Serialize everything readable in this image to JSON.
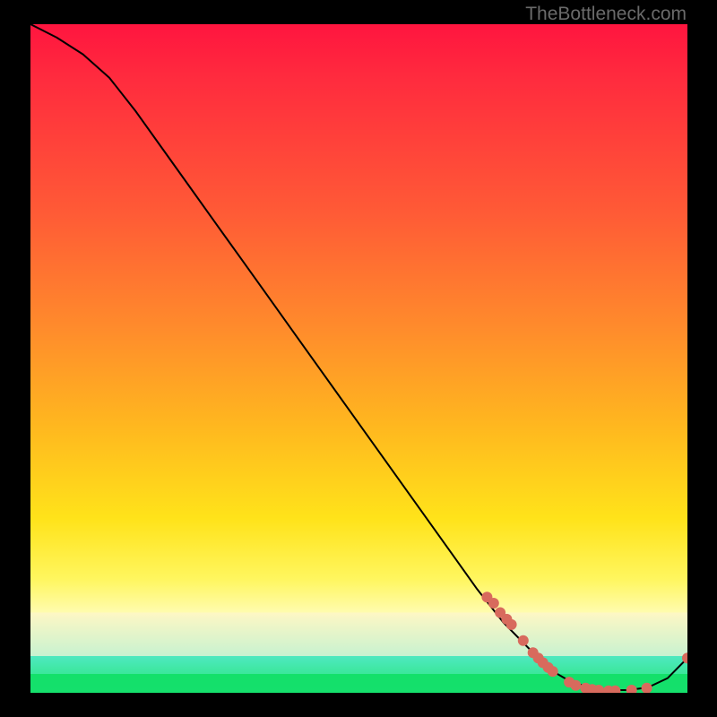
{
  "watermark": "TheBottleneck.com",
  "colors": {
    "curve": "#000000",
    "marker": "#d86a5d",
    "bg_top": "#ff153f",
    "bg_mid": "#ffe31a",
    "bg_band": "#13e06a"
  },
  "chart_data": {
    "type": "line",
    "title": "",
    "xlabel": "",
    "ylabel": "",
    "xlim": [
      0,
      100
    ],
    "ylim": [
      0,
      100
    ],
    "grid": false,
    "legend": false,
    "series": [
      {
        "name": "bottleneck-curve",
        "x": [
          0,
          4,
          8,
          12,
          16,
          20,
          24,
          28,
          32,
          36,
          40,
          44,
          48,
          52,
          56,
          60,
          64,
          68,
          72,
          76,
          79,
          82,
          85,
          88,
          91,
          94,
          97,
          100
        ],
        "y": [
          100,
          98,
          95.5,
          92,
          87,
          81.5,
          76,
          70.5,
          65,
          59.5,
          54,
          48.5,
          43,
          37.5,
          32,
          26.5,
          21,
          15.5,
          10.5,
          6.5,
          3.5,
          1.8,
          0.8,
          0.4,
          0.4,
          0.8,
          2.2,
          5.2
        ]
      }
    ],
    "markers": [
      {
        "x": 69.5,
        "y": 14.3
      },
      {
        "x": 70.5,
        "y": 13.4
      },
      {
        "x": 71.5,
        "y": 12.0
      },
      {
        "x": 72.5,
        "y": 11.0
      },
      {
        "x": 73.2,
        "y": 10.2
      },
      {
        "x": 75.0,
        "y": 7.8
      },
      {
        "x": 76.5,
        "y": 6.0
      },
      {
        "x": 77.3,
        "y": 5.2
      },
      {
        "x": 78.0,
        "y": 4.5
      },
      {
        "x": 78.8,
        "y": 3.8
      },
      {
        "x": 79.5,
        "y": 3.2
      },
      {
        "x": 82.0,
        "y": 1.6
      },
      {
        "x": 83.0,
        "y": 1.1
      },
      {
        "x": 84.5,
        "y": 0.7
      },
      {
        "x": 85.5,
        "y": 0.5
      },
      {
        "x": 86.5,
        "y": 0.4
      },
      {
        "x": 88.0,
        "y": 0.3
      },
      {
        "x": 89.0,
        "y": 0.3
      },
      {
        "x": 91.5,
        "y": 0.4
      },
      {
        "x": 93.8,
        "y": 0.7
      },
      {
        "x": 100.0,
        "y": 5.2
      }
    ]
  }
}
